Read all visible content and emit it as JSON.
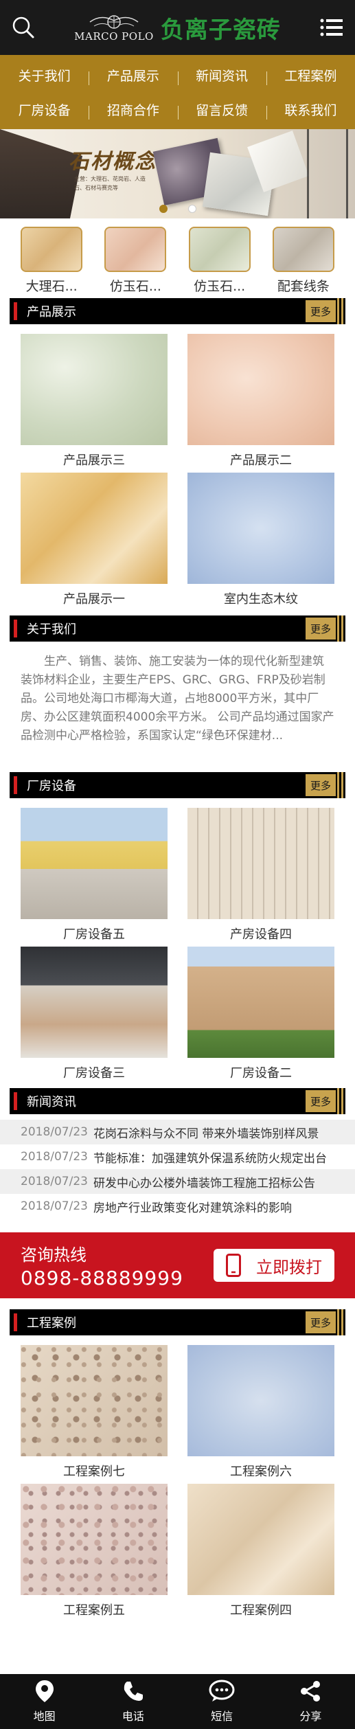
{
  "header": {
    "brand_en": "MARCO POLO",
    "brand_cn": "负离子瓷砖"
  },
  "nav": {
    "row1": [
      "关于我们",
      "产品展示",
      "新闻资讯",
      "工程案例"
    ],
    "row2": [
      "厂房设备",
      "招商合作",
      "留言反馈",
      "联系我们"
    ]
  },
  "banner": {
    "title": "石材概念",
    "subtitle": "主营：大理石、花岗岩、人造石、石材马赛克等"
  },
  "categories": [
    "大理石...",
    "仿玉石...",
    "仿玉石...",
    "配套线条"
  ],
  "sections": {
    "products": {
      "title": "产品展示",
      "more": "更多",
      "items": [
        "产品展示三",
        "产品展示二",
        "产品展示一",
        "室内生态木纹"
      ]
    },
    "about": {
      "title": "关于我们",
      "more": "更多",
      "text": "生产、销售、装饰、施工安装为一体的现代化新型建筑装饰材料企业，主要生产EPS、GRC、GRG、FRP及砂岩制品。公司地处海口市椰海大道，占地8000平方米，其中厂房、办公区建筑面积4000余平方米。    公司产品均通过国家产品检测中心严格检验，系国家认定“绿色环保建材..."
    },
    "factory": {
      "title": "厂房设备",
      "more": "更多",
      "items": [
        "厂房设备五",
        "产房设备四",
        "厂房设备三",
        "厂房设备二"
      ]
    },
    "news": {
      "title": "新闻资讯",
      "more": "更多",
      "items": [
        {
          "date": "2018/07/23",
          "title": "花岗石涂料与众不同 带来外墙装饰别样风景"
        },
        {
          "date": "2018/07/23",
          "title": "节能标准：加强建筑外保温系统防火规定出台"
        },
        {
          "date": "2018/07/23",
          "title": "研发中心办公楼外墙装饰工程施工招标公告"
        },
        {
          "date": "2018/07/23",
          "title": "房地产行业政策变化对建筑涂料的影响"
        }
      ]
    },
    "cases": {
      "title": "工程案例",
      "more": "更多",
      "items": [
        "工程案例七",
        "工程案例六",
        "工程案例五",
        "工程案例四"
      ]
    }
  },
  "hotline": {
    "label": "咨询热线",
    "number": "0898-88889999",
    "button": "立即拨打"
  },
  "footer": [
    "地图",
    "电话",
    "短信",
    "分享"
  ],
  "colors": {
    "nav_gold": "#a97f1c",
    "accent_red": "#c8141f",
    "header_dark": "#1a1a1a",
    "brand_green": "#2a9a3d"
  }
}
